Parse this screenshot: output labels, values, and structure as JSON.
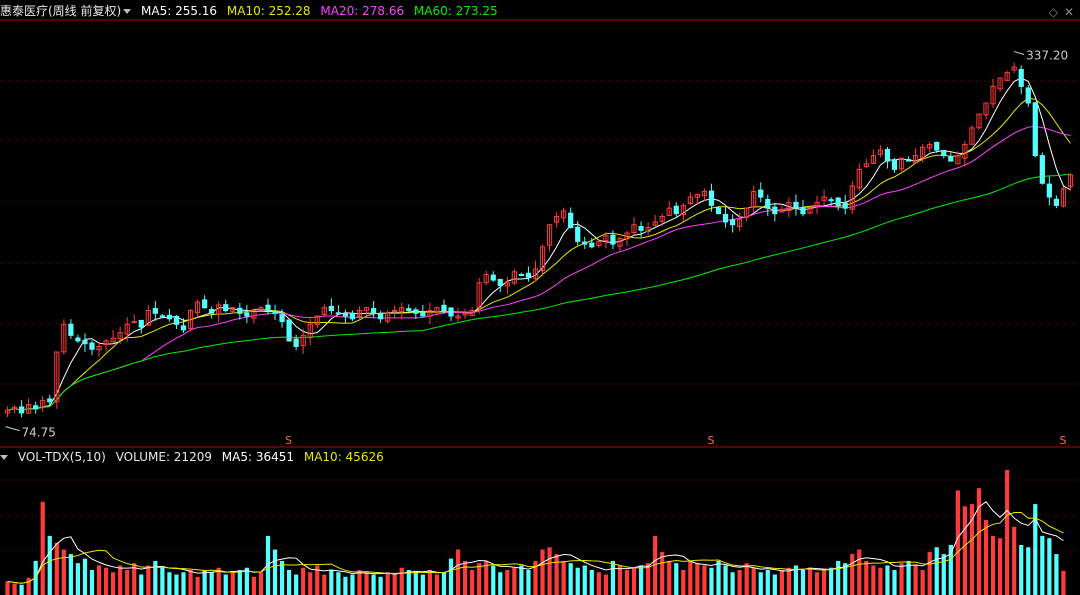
{
  "header": {
    "stock_name": "惠泰医疗(周线 前复权)",
    "ma5": "MA5: 255.16",
    "ma10": "MA10: 252.28",
    "ma20": "MA20: 278.66",
    "ma60": "MA60: 273.25"
  },
  "volume_header": {
    "indicator": "VOL-TDX(5,10)",
    "volume": "VOLUME: 21209",
    "ma5": "MA5: 36451",
    "ma10": "MA10: 45626"
  },
  "annotations": {
    "high_label": "337.20",
    "low_label": "74.75",
    "dividend_marker": "S"
  },
  "colors": {
    "up": "#ff3b3b",
    "down": "#54ffff",
    "ma5": "#ffffff",
    "ma10": "#e8e800",
    "ma20": "#ff40ff",
    "ma60": "#00ee00",
    "grid": "#7a0000",
    "axis": "#b00000"
  },
  "chart_data": {
    "type": "candlestick",
    "price_range": [
      60,
      360
    ],
    "volume_range": [
      0,
      110000
    ],
    "high": 337.2,
    "low": 74.75,
    "dividend_marks_at": [
      40,
      100,
      150
    ],
    "close_series": [
      78,
      80,
      76,
      82,
      79,
      85,
      84,
      120,
      140,
      132,
      128,
      126,
      122,
      124,
      128,
      130,
      134,
      140,
      142,
      138,
      150,
      148,
      146,
      144,
      140,
      136,
      150,
      156,
      152,
      148,
      154,
      150,
      152,
      148,
      146,
      150,
      152,
      150,
      148,
      142,
      128,
      124,
      132,
      140,
      146,
      152,
      150,
      148,
      146,
      144,
      150,
      152,
      148,
      144,
      148,
      150,
      152,
      150,
      148,
      146,
      150,
      152,
      150,
      146,
      146,
      148,
      150,
      170,
      176,
      172,
      168,
      170,
      178,
      176,
      174,
      180,
      196,
      212,
      218,
      222,
      210,
      200,
      198,
      196,
      200,
      204,
      198,
      202,
      206,
      212,
      208,
      210,
      214,
      218,
      224,
      220,
      226,
      232,
      234,
      236,
      226,
      220,
      214,
      212,
      216,
      224,
      236,
      232,
      224,
      220,
      222,
      228,
      224,
      220,
      224,
      228,
      232,
      230,
      226,
      224,
      240,
      252,
      256,
      262,
      266,
      258,
      252,
      260,
      258,
      262,
      268,
      270,
      266,
      262,
      258,
      262,
      270,
      282,
      292,
      300,
      312,
      318,
      322,
      326,
      312,
      300,
      262,
      242,
      232,
      226,
      238,
      248
    ],
    "volume": [
      12000,
      10000,
      9000,
      15000,
      30000,
      82000,
      52000,
      46000,
      40000,
      36000,
      28000,
      32000,
      22000,
      26000,
      24000,
      20000,
      26000,
      22000,
      28000,
      18000,
      26000,
      30000,
      24000,
      20000,
      18000,
      20000,
      22000,
      16000,
      22000,
      20000,
      24000,
      18000,
      20000,
      22000,
      24000,
      16000,
      20000,
      52000,
      40000,
      30000,
      22000,
      18000,
      24000,
      20000,
      26000,
      18000,
      22000,
      20000,
      16000,
      18000,
      22000,
      20000,
      18000,
      16000,
      20000,
      18000,
      24000,
      22000,
      20000,
      18000,
      22000,
      18000,
      20000,
      32000,
      40000,
      30000,
      22000,
      28000,
      30000,
      26000,
      20000,
      22000,
      24000,
      26000,
      22000,
      30000,
      40000,
      42000,
      36000,
      30000,
      28000,
      24000,
      26000,
      22000,
      20000,
      18000,
      30000,
      26000,
      22000,
      24000,
      26000,
      28000,
      52000,
      38000,
      30000,
      28000,
      22000,
      30000,
      28000,
      26000,
      24000,
      30000,
      26000,
      20000,
      22000,
      28000,
      24000,
      20000,
      22000,
      18000,
      22000,
      24000,
      26000,
      22000,
      24000,
      20000,
      22000,
      24000,
      30000,
      28000,
      36000,
      40000,
      30000,
      26000,
      24000,
      26000,
      22000,
      28000,
      30000,
      26000,
      22000,
      38000,
      42000,
      36000,
      44000,
      92000,
      78000,
      80000,
      94000,
      66000,
      52000,
      50000,
      110000,
      60000,
      44000,
      42000,
      80000,
      52000,
      50000,
      36000,
      21209
    ]
  }
}
